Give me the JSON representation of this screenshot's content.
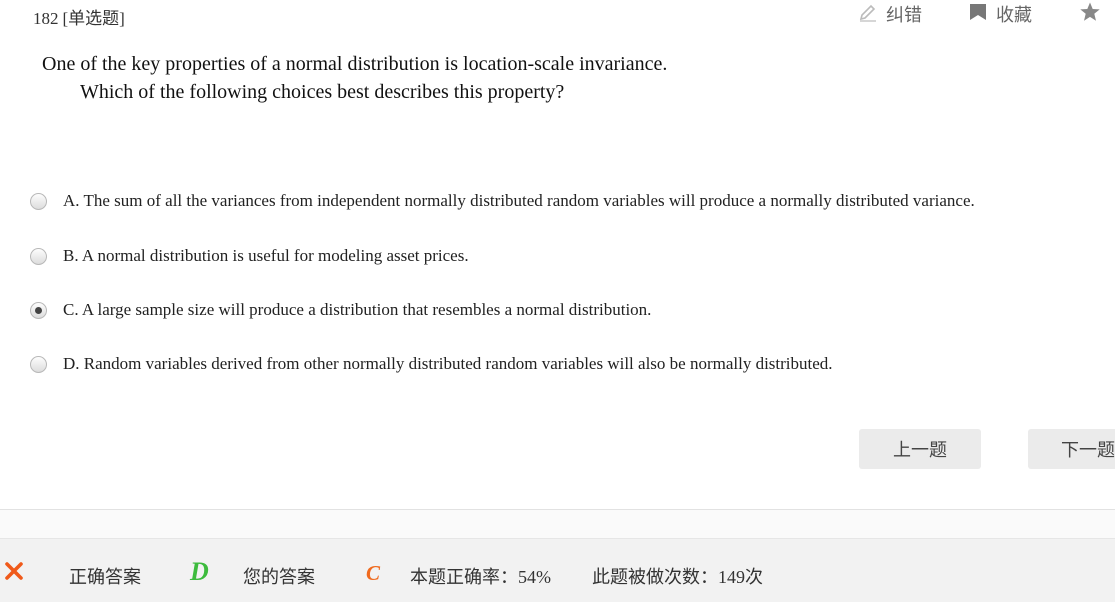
{
  "question": {
    "number": "182",
    "type_tag": "[单选题]",
    "text_line1": "One of the key properties of a normal distribution is location-scale invariance.",
    "text_line2": "Which of the following choices best describes this property?"
  },
  "toolbar": {
    "report_label": "纠错",
    "favorite_label": "收藏"
  },
  "options": [
    {
      "text": "A. The sum of all the variances from independent normally distributed random variables will produce a normally distributed variance.",
      "selected": false
    },
    {
      "text": "B. A normal distribution is useful for modeling asset prices.",
      "selected": false
    },
    {
      "text": "C. A large sample size will produce a distribution that resembles a normal distribution.",
      "selected": true
    },
    {
      "text": "D. Random variables derived from other normally distributed random variables will also be normally distributed.",
      "selected": false
    }
  ],
  "navigation": {
    "prev_label": "上一题",
    "next_label": "下一题"
  },
  "result": {
    "status_icon": "wrong-x-icon",
    "correct_label": "正确答案",
    "correct_value": "D",
    "your_label": "您的答案",
    "your_value": "C",
    "rate_text": "本题正确率：54%",
    "count_text": "此题被做次数：149次",
    "colors": {
      "correct": "#3dbb3d",
      "wrong": "#f06a1e",
      "x_icon": "#f05a1a"
    }
  }
}
